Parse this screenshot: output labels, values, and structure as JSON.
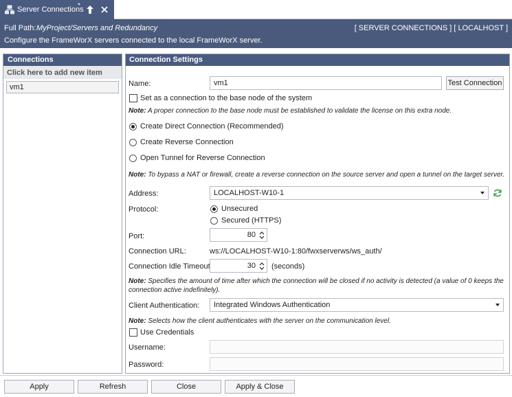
{
  "tab": {
    "title": "Server Connections",
    "modified_marker": "*"
  },
  "header": {
    "fullpath_label": "Full Path:",
    "fullpath_value": "MyProject/Servers and Redundancy",
    "breadcrumb": "[ SERVER CONNECTIONS ] [ LOCALHOST ]",
    "description": "Configure the FrameWorX servers connected to the local FrameWorX server."
  },
  "connections": {
    "title": "Connections",
    "add_item": "Click here to add new item",
    "items": [
      "vm1"
    ]
  },
  "settings": {
    "title": "Connection Settings",
    "name_label": "Name:",
    "name_value": "vm1",
    "test_button": "Test Connection",
    "base_node_label": "Set as a connection to the base node of the system",
    "note1_bold": "Note:",
    "note1_text": " A proper connection to the base node must be established to validate the license on this extra node.",
    "radio_direct": "Create Direct Connection (Recommended)",
    "radio_reverse": "Create Reverse Connection",
    "radio_tunnel": "Open Tunnel for Reverse Connection",
    "note2_bold": "Note:",
    "note2_text": " To bypass a NAT or firewall, create a reverse connection on the source server and open a tunnel on the target server.",
    "address_label": "Address:",
    "address_value": "LOCALHOST-W10-1",
    "protocol_label": "Protocol:",
    "protocol_unsecured": "Unsecured",
    "protocol_secured": "Secured (HTTPS)",
    "port_label": "Port:",
    "port_value": "80",
    "url_label": "Connection URL:",
    "url_value": "ws://LOCALHOST-W10-1:80/fwxserverws/ws_auth/",
    "idle_label": "Connection Idle Timeout:",
    "idle_value": "30",
    "idle_unit": "(seconds)",
    "note3_bold": "Note:",
    "note3_line1": " Specifies the amount of time after which the connection will be closed if no activity is detected (a value of 0 keeps the",
    "note3_line2": "connection active indefinitely).",
    "auth_label": "Client Authentication:",
    "auth_value": "Integrated Windows Authentication",
    "note4_bold": "Note:",
    "note4_text": " Selects how the client authenticates with the server on the communication level.",
    "credentials_label": "Use Credentials",
    "username_label": "Username:",
    "password_label": "Password:"
  },
  "footer": {
    "apply": "Apply",
    "refresh": "Refresh",
    "close": "Close",
    "apply_close": "Apply & Close"
  },
  "colors": {
    "header_bg": "#4a5a7c",
    "refresh_icon": "#3aa04a"
  }
}
